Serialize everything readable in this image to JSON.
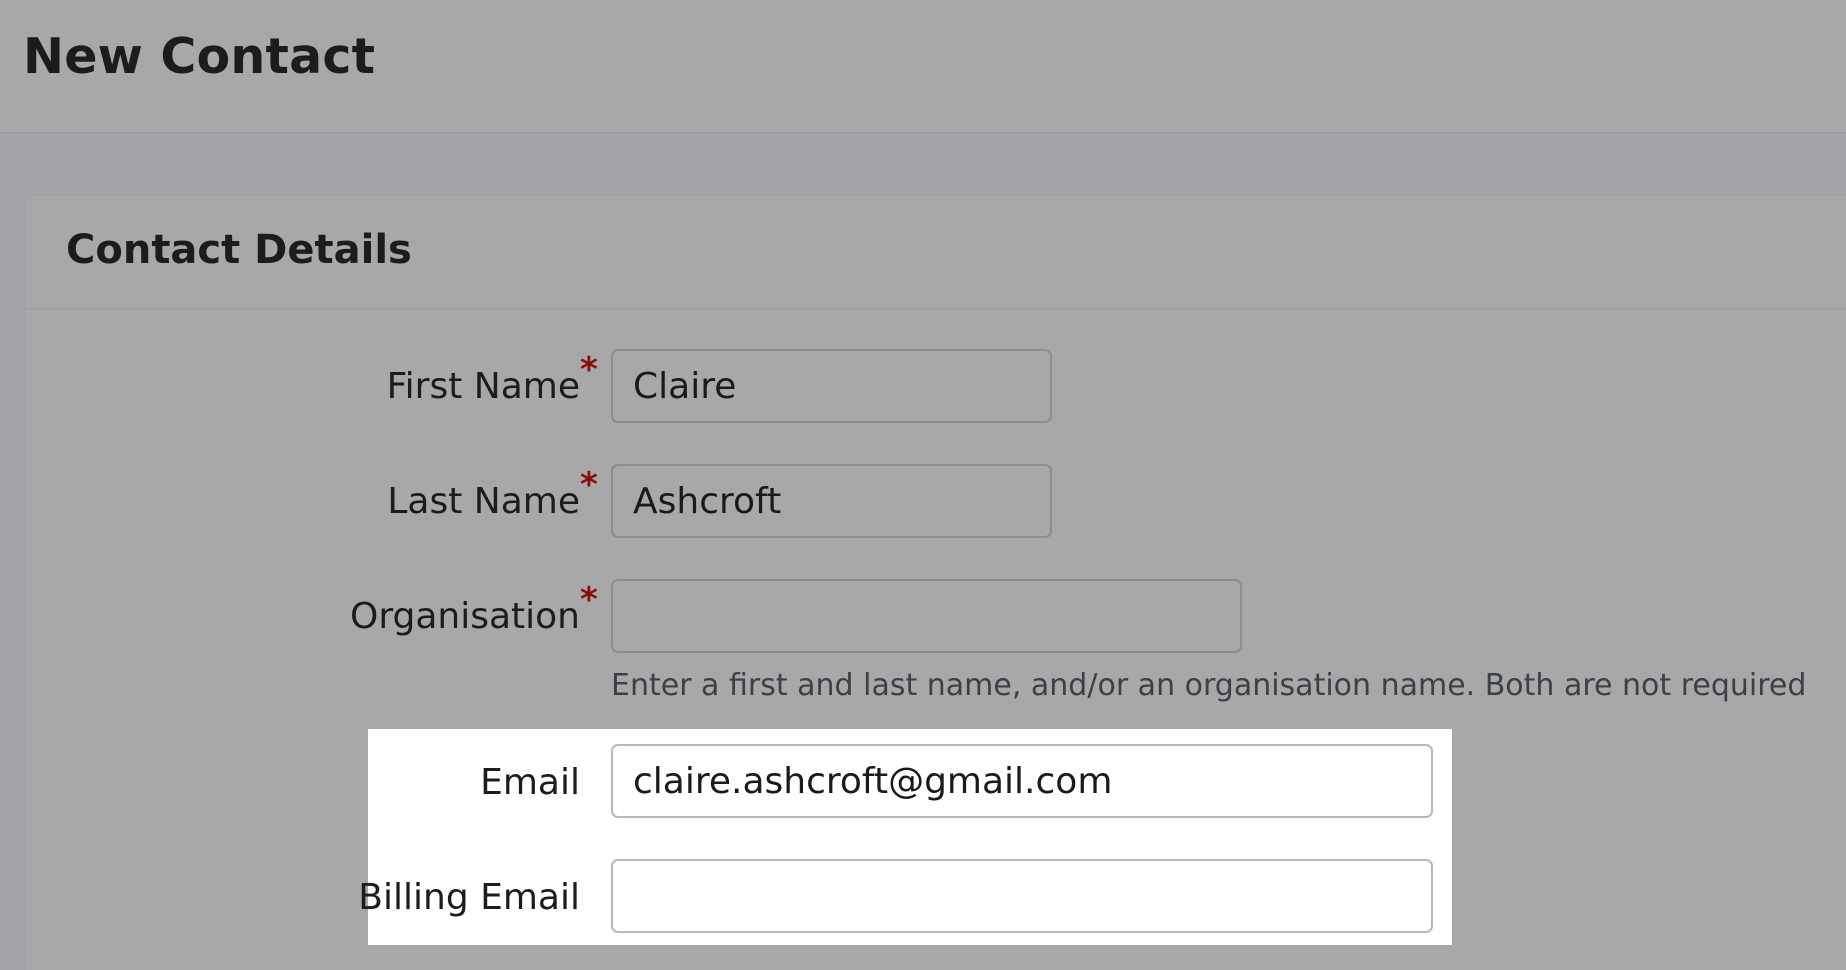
{
  "page": {
    "title": "New Contact"
  },
  "panel": {
    "title": "Contact Details"
  },
  "form": {
    "first_name": {
      "label": "First Name",
      "required_mark": "*",
      "value": "Claire"
    },
    "last_name": {
      "label": "Last Name",
      "required_mark": "*",
      "value": "Ashcroft"
    },
    "organisation": {
      "label": "Organisation",
      "required_mark": "*",
      "value": ""
    },
    "name_hint": "Enter a first and last name, and/or an organisation name. Both are not required",
    "email": {
      "label": "Email",
      "value": "claire.ashcroft@gmail.com"
    },
    "billing_email": {
      "label": "Billing Email",
      "value": ""
    }
  },
  "colors": {
    "required_mark": "#8b0e0e",
    "overlay_background": "#a8a8a8",
    "highlight_background": "#ffffff"
  }
}
